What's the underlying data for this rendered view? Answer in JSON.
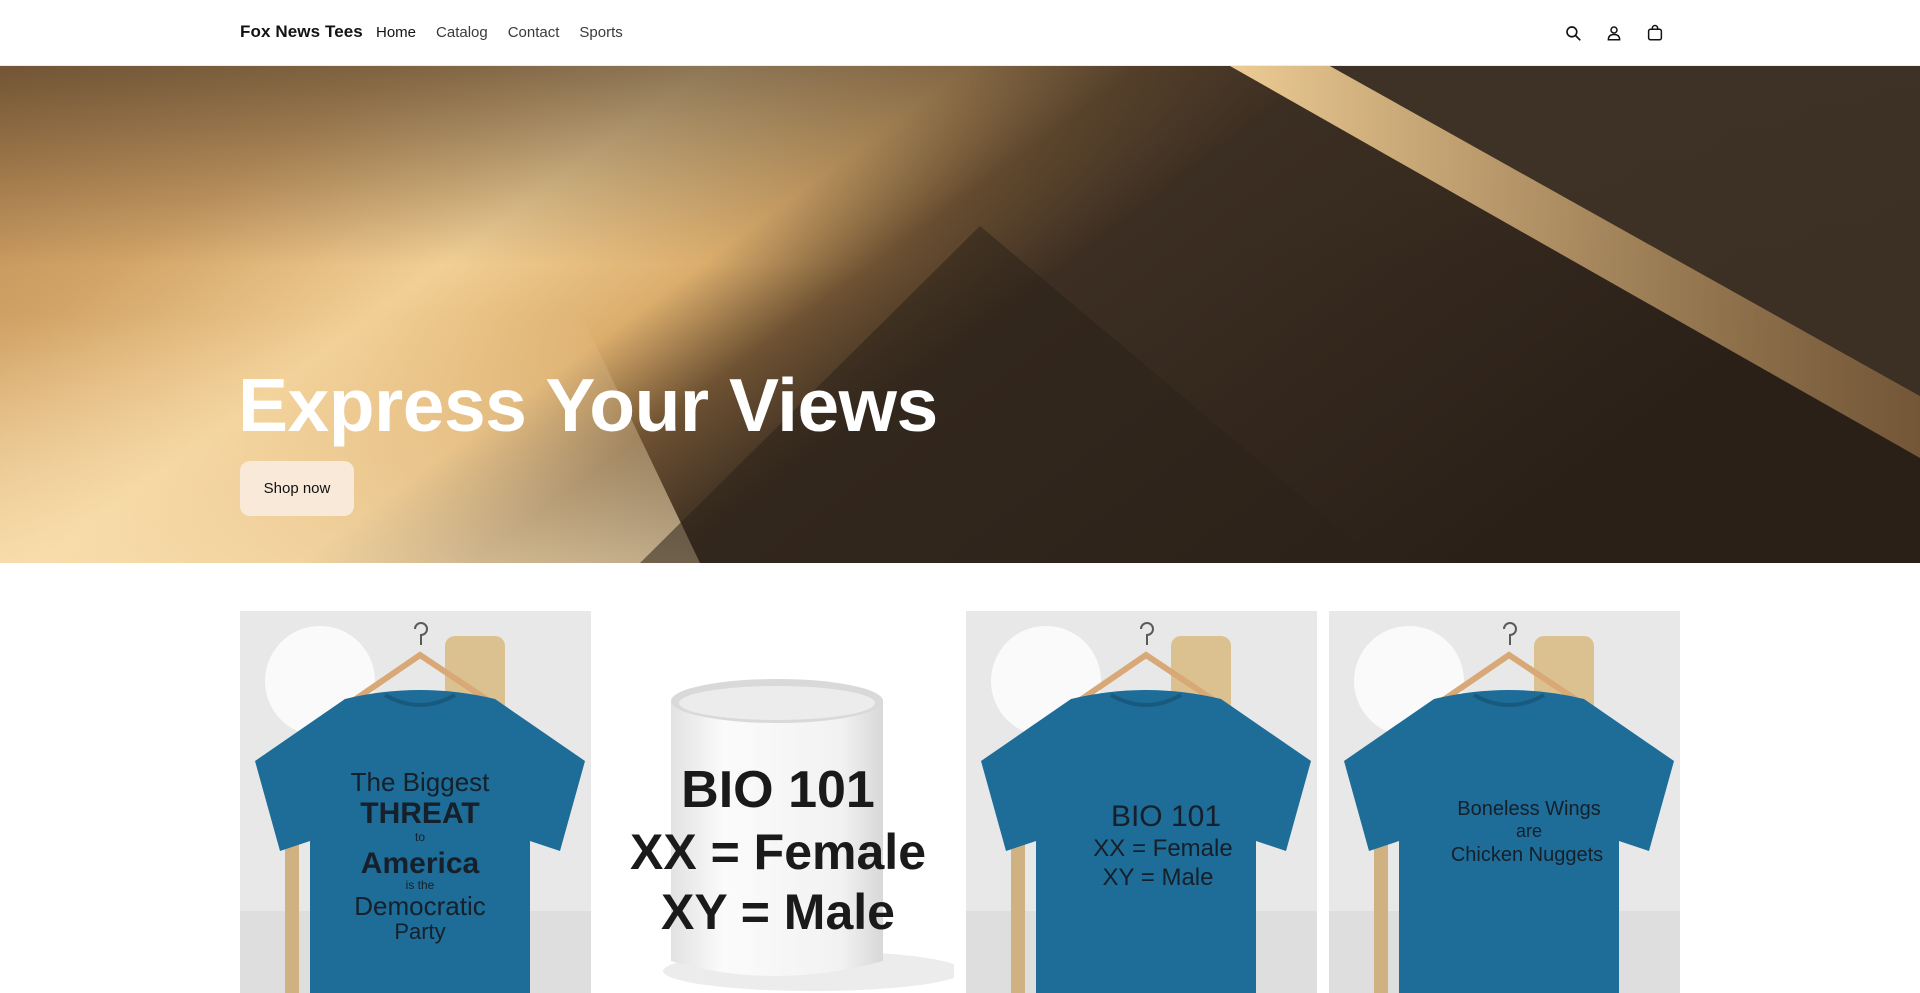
{
  "header": {
    "brand": "Fox News Tees",
    "nav": [
      "Home",
      "Catalog",
      "Contact",
      "Sports"
    ],
    "icons": [
      "search-icon",
      "account-icon",
      "cart-icon"
    ]
  },
  "hero": {
    "title": "Express Your Views",
    "button_label": "Shop now",
    "button_color": "#f9e9d8"
  },
  "products": [
    {
      "type": "t-shirt",
      "print_lines": [
        "The Biggest",
        "THREAT",
        "to",
        "America",
        "is the",
        "Democratic",
        "Party"
      ],
      "shirt_color": "#1e6c98"
    },
    {
      "type": "mug",
      "print_lines": [
        "BIO 101",
        "XX = Female",
        "XY = Male"
      ]
    },
    {
      "type": "t-shirt",
      "print_lines": [
        "BIO 101",
        "XX = Female",
        "XY = Male"
      ],
      "shirt_color": "#1e6c98"
    },
    {
      "type": "t-shirt",
      "print_lines": [
        "Boneless Wings",
        "are",
        "Chicken Nuggets"
      ],
      "shirt_color": "#1e6c98"
    }
  ]
}
